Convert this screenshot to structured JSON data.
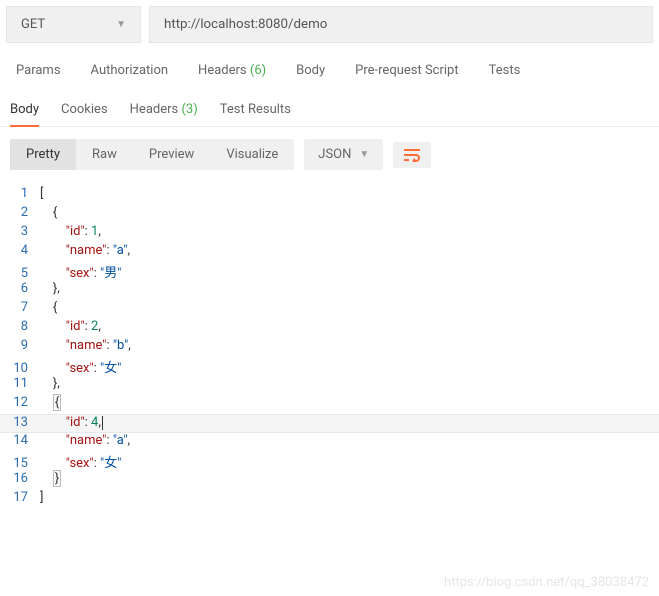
{
  "method": "GET",
  "url": "http://localhost:8080/demo",
  "reqTabs": {
    "params": "Params",
    "authorization": "Authorization",
    "headers": "Headers",
    "headersCount": "(6)",
    "body": "Body",
    "prerequest": "Pre-request Script",
    "tests": "Tests"
  },
  "respTabs": {
    "body": "Body",
    "cookies": "Cookies",
    "headers": "Headers",
    "headersCount": "(3)",
    "testResults": "Test Results"
  },
  "viewBtns": {
    "pretty": "Pretty",
    "raw": "Raw",
    "preview": "Preview",
    "visualize": "Visualize"
  },
  "format": "JSON",
  "codeLines": [
    {
      "n": "1",
      "tokens": [
        "[",
        "brace"
      ]
    },
    {
      "n": "2",
      "tokens": [
        "    ",
        "{",
        "brace"
      ]
    },
    {
      "n": "3",
      "tokens": [
        "        ",
        "\"id\"",
        "key",
        ": ",
        "1",
        "num",
        ","
      ]
    },
    {
      "n": "4",
      "tokens": [
        "        ",
        "\"name\"",
        "key",
        ": ",
        "\"a\"",
        "str",
        ","
      ]
    },
    {
      "n": "5",
      "tokens": [
        "        ",
        "\"sex\"",
        "key",
        ": ",
        "\"男\"",
        "str"
      ]
    },
    {
      "n": "6",
      "tokens": [
        "    ",
        "},",
        "brace"
      ]
    },
    {
      "n": "7",
      "tokens": [
        "    ",
        "{",
        "brace"
      ]
    },
    {
      "n": "8",
      "tokens": [
        "        ",
        "\"id\"",
        "key",
        ": ",
        "2",
        "num",
        ","
      ]
    },
    {
      "n": "9",
      "tokens": [
        "        ",
        "\"name\"",
        "key",
        ": ",
        "\"b\"",
        "str",
        ","
      ]
    },
    {
      "n": "10",
      "tokens": [
        "        ",
        "\"sex\"",
        "key",
        ": ",
        "\"女\"",
        "str"
      ]
    },
    {
      "n": "11",
      "tokens": [
        "    ",
        "},",
        "brace"
      ]
    },
    {
      "n": "12",
      "tokens": [
        "    ",
        "{",
        "boxed"
      ]
    },
    {
      "n": "13",
      "tokens": [
        "        ",
        "\"id\"",
        "key",
        ": ",
        "4",
        "num",
        ","
      ],
      "hl": true,
      "cursor": true
    },
    {
      "n": "14",
      "tokens": [
        "        ",
        "\"name\"",
        "key",
        ": ",
        "\"a\"",
        "str",
        ","
      ]
    },
    {
      "n": "15",
      "tokens": [
        "        ",
        "\"sex\"",
        "key",
        ": ",
        "\"女\"",
        "str"
      ]
    },
    {
      "n": "16",
      "tokens": [
        "    ",
        "}",
        "boxed"
      ]
    },
    {
      "n": "17",
      "tokens": [
        "]",
        "brace"
      ]
    }
  ],
  "watermark": "https://blog.csdn.net/qq_38038472"
}
